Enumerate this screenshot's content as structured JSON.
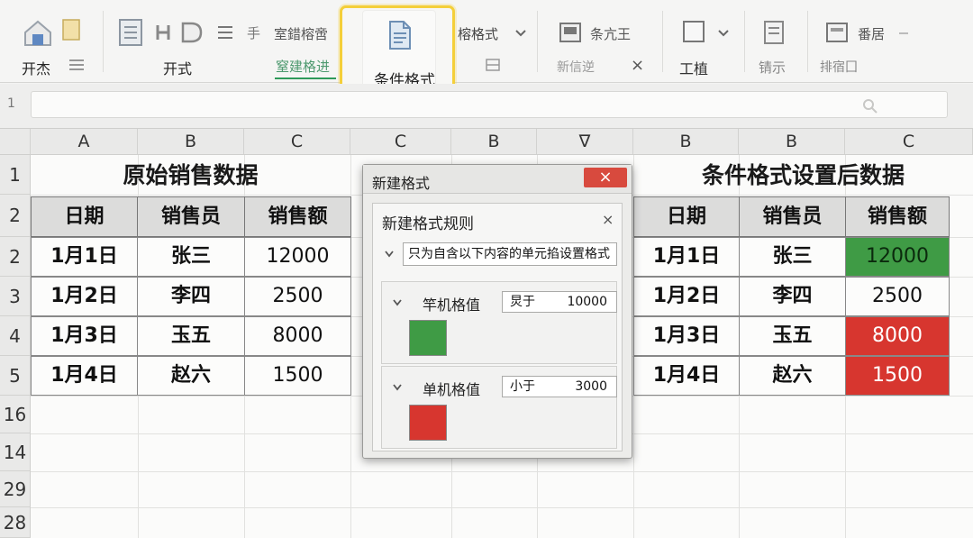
{
  "ribbon": {
    "home_label": "开杰",
    "home_group_label": "开式",
    "new_rule_top": "室錯榕啻",
    "new_rule_bottom": "窒建格进",
    "conditional_format_label": "条件格式",
    "table_format_label": "榕格式",
    "cell_style_label": "条亢王",
    "new_style_label": "新信逆",
    "x_label": "×",
    "tools_label": "工植",
    "display_label": "锖示",
    "extra_label": "番居",
    "layout_label": "排宿囗"
  },
  "row_numbers": [
    "1",
    "2",
    "2",
    "3",
    "4",
    "5",
    "16",
    "14",
    "29",
    "28"
  ],
  "formula_bar": {
    "row_label": "1"
  },
  "columns": [
    "A",
    "B",
    "C",
    "C",
    "B",
    "∇",
    "B",
    "B",
    "C"
  ],
  "left_table": {
    "title": "原始销售数据",
    "headers": [
      "日期",
      "销售员",
      "销售额"
    ],
    "rows": [
      [
        "1月1日",
        "张三",
        "12000"
      ],
      [
        "1月2日",
        "李四",
        "2500"
      ],
      [
        "1月3日",
        "玉五",
        "8000"
      ],
      [
        "1月4日",
        "赵六",
        "1500"
      ]
    ]
  },
  "right_table": {
    "title": "条件格式设置后数据",
    "headers": [
      "日期",
      "销售员",
      "销售额"
    ],
    "rows": [
      [
        "1月1日",
        "张三",
        "12000"
      ],
      [
        "1月2日",
        "李四",
        "2500"
      ],
      [
        "1月3日",
        "玉五",
        "8000"
      ],
      [
        "1月4日",
        "赵六",
        "1500"
      ]
    ],
    "highlight": [
      "green",
      "none",
      "red",
      "red"
    ]
  },
  "dialog": {
    "title": "新建格式",
    "close": "×",
    "subtitle": "新建格式规则",
    "subtitle_close": "×",
    "rule_type": "只为自含以下内容的单元掐设置格式",
    "rule1": {
      "label": "竿机格值",
      "operator": "炅于",
      "value": "10000",
      "color": "#3f9b45"
    },
    "rule2": {
      "label": "单机格值",
      "operator": "小于",
      "value": "3000",
      "color": "#d7362f"
    }
  },
  "colors": {
    "accent_highlight": "#f4cf3a",
    "green": "#3f9b45",
    "red": "#d7362f"
  }
}
